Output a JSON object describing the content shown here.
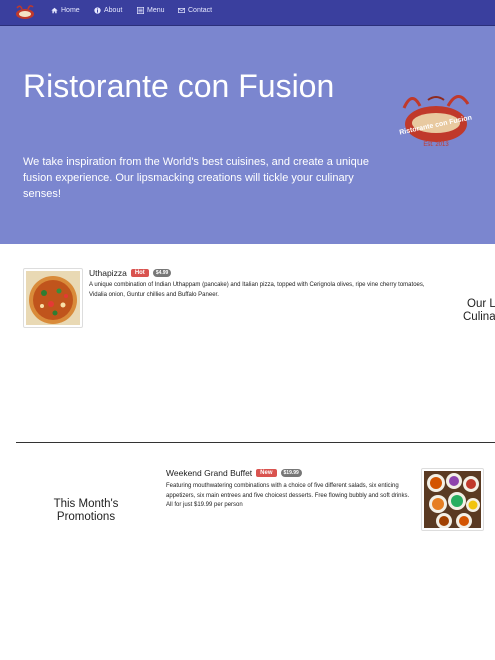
{
  "nav": {
    "items": [
      {
        "label": "Home",
        "icon": "home-icon"
      },
      {
        "label": "About",
        "icon": "info-icon"
      },
      {
        "label": "Menu",
        "icon": "list-icon"
      },
      {
        "label": "Contact",
        "icon": "envelope-icon"
      }
    ]
  },
  "jumbotron": {
    "title": "Ristorante con Fusion",
    "text": "We take inspiration from the World's best cuisines, and create a unique fusion experience. Our lipsmacking creations will tickle your culinary senses!",
    "logo_text": "Ristorante con Fusion",
    "logo_est": "Est. 2013"
  },
  "featured_dish": {
    "name": "Uthapizza",
    "label": "Hot",
    "price": "$4.99",
    "description": "A unique combination of Indian Uthappam (pancake) and Italian pizza, topped with Cerignola olives, ripe vine cherry tomatoes, Vidalia onion, Guntur chillies and Buffalo Paneer."
  },
  "right_heading_partial": [
    "Our L",
    "Culina"
  ],
  "promotion": {
    "section_heading": "This Month's Promotions",
    "name": "Weekend Grand Buffet",
    "label": "New",
    "price": "$19.99",
    "description": "Featuring mouthwatering combinations with a choice of five different salads, six enticing appetizers, six main entrees and five choicest desserts. Free flowing bubbly and soft drinks. All for just $19.99 per person"
  },
  "colors": {
    "navbar": "#3a3f9e",
    "jumbotron": "#7b86cf",
    "badge_hot": "#d9534f",
    "badge_price": "#777777"
  }
}
